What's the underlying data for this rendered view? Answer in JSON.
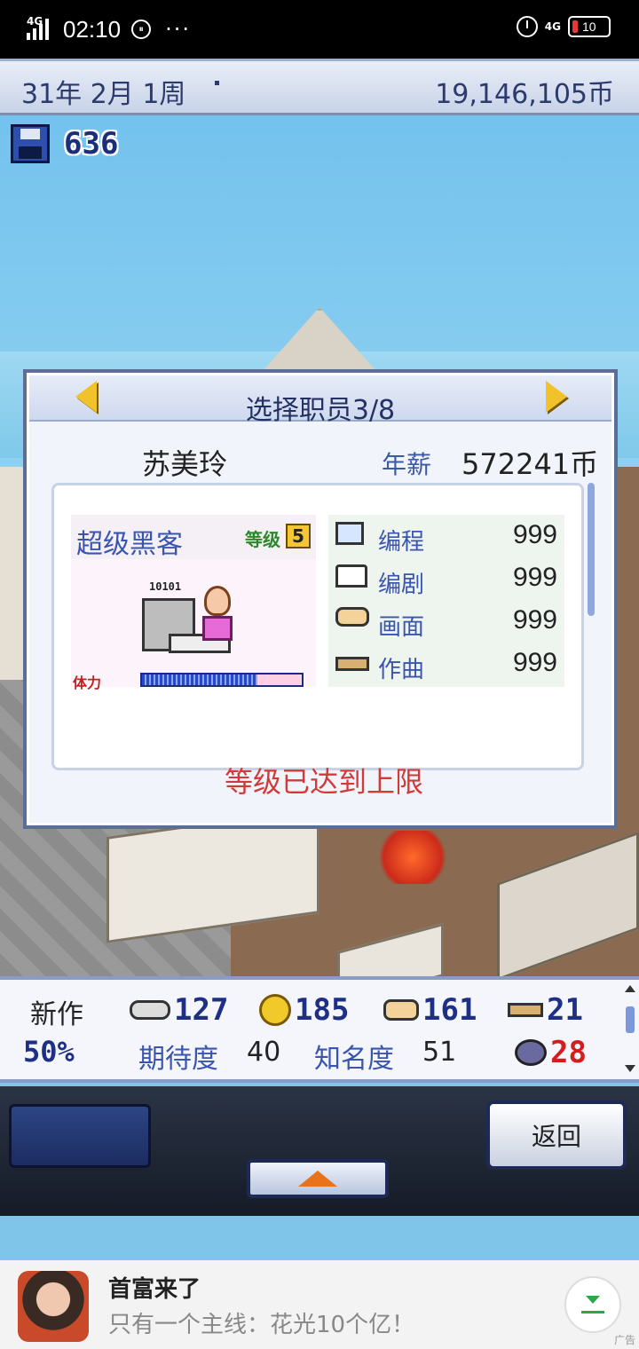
{
  "status_bar": {
    "network": "4G",
    "time": "02:10",
    "dots": "···",
    "network_right": "4G",
    "battery": "10",
    "badge": "⑩"
  },
  "top_bar": {
    "date": "31年 2月 1周",
    "money": "19,146,105币"
  },
  "disk_count": "636",
  "dialog": {
    "title": "选择职员3/8",
    "employee_name": "苏美玲",
    "salary_label": "年薪",
    "salary_value": "572241币",
    "job_title": "超级黑客",
    "level_label": "等级",
    "level_value": "5",
    "art_text": "10101",
    "stamina_label": "体力",
    "stamina_fraction": 0.72,
    "skills": [
      {
        "icon": "monitor-icon",
        "name": "编程",
        "value": "999"
      },
      {
        "icon": "book-icon",
        "name": "编剧",
        "value": "999"
      },
      {
        "icon": "paint-icon",
        "name": "画面",
        "value": "999"
      },
      {
        "icon": "music-icon",
        "name": "作曲",
        "value": "999"
      }
    ],
    "limit_message": "等级已达到上限"
  },
  "stats": {
    "new_label": "新作",
    "percent": "50%",
    "fun": "127",
    "creativity": "185",
    "graphics": "161",
    "sound": "21",
    "bugs": "28",
    "expectation_label": "期待度",
    "expectation_value": "40",
    "fame_label": "知名度",
    "fame_value": "51"
  },
  "controls": {
    "back_label": "返回"
  },
  "ad": {
    "title": "首富来了",
    "subtitle": "只有一个主线：花光10个亿！",
    "tag": "广告"
  },
  "colors": {
    "accent_blue": "#3955b0",
    "limit_red": "#d23a3a",
    "dialog_border": "#5b6e98"
  }
}
